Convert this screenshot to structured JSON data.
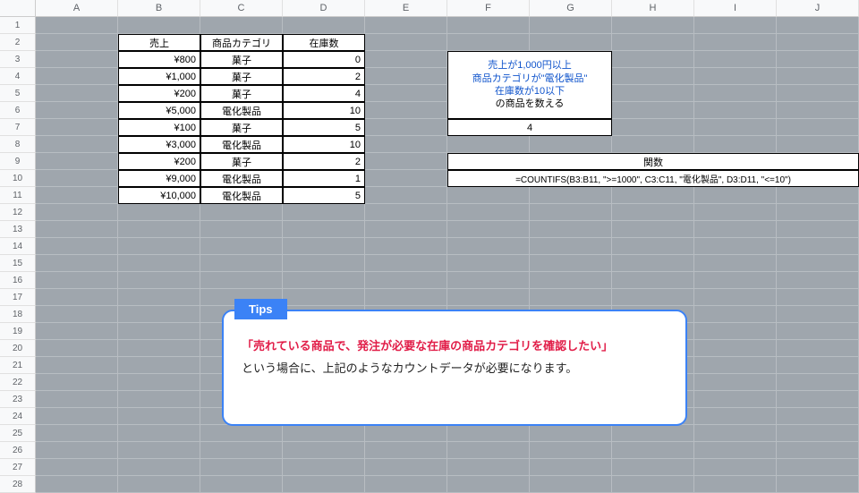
{
  "columns": [
    "A",
    "B",
    "C",
    "D",
    "E",
    "F",
    "G",
    "H",
    "I",
    "J"
  ],
  "rows": 28,
  "table": {
    "headers": [
      "売上",
      "商品カテゴリ",
      "在庫数"
    ],
    "data": [
      {
        "sales": "¥800",
        "cat": "菓子",
        "stock": "0"
      },
      {
        "sales": "¥1,000",
        "cat": "菓子",
        "stock": "2"
      },
      {
        "sales": "¥200",
        "cat": "菓子",
        "stock": "4"
      },
      {
        "sales": "¥5,000",
        "cat": "電化製品",
        "stock": "10"
      },
      {
        "sales": "¥100",
        "cat": "菓子",
        "stock": "5"
      },
      {
        "sales": "¥3,000",
        "cat": "電化製品",
        "stock": "10"
      },
      {
        "sales": "¥200",
        "cat": "菓子",
        "stock": "2"
      },
      {
        "sales": "¥9,000",
        "cat": "電化製品",
        "stock": "1"
      },
      {
        "sales": "¥10,000",
        "cat": "電化製品",
        "stock": "5"
      }
    ]
  },
  "cond": {
    "l1": "売上が1,000円以上",
    "l2": "商品カテゴリが\"電化製品\"",
    "l3": "在庫数が10以下",
    "l4": "の商品を数える"
  },
  "result": "4",
  "fn": {
    "header": "関数",
    "formula": "=COUNTIFS(B3:B11, \">=1000\", C3:C11, \"電化製品\", D3:D11, \"<=10\")"
  },
  "tips": {
    "tab": "Tips",
    "l1": "「売れている商品で、発注が必要な在庫の商品カテゴリを確認したい」",
    "l2": "という場合に、上記のようなカウントデータが必要になります。"
  },
  "chart_data": {
    "type": "table",
    "title": "COUNTIFS example",
    "columns": [
      "売上",
      "商品カテゴリ",
      "在庫数"
    ],
    "rows": [
      [
        800,
        "菓子",
        0
      ],
      [
        1000,
        "菓子",
        2
      ],
      [
        200,
        "菓子",
        4
      ],
      [
        5000,
        "電化製品",
        10
      ],
      [
        100,
        "菓子",
        5
      ],
      [
        3000,
        "電化製品",
        10
      ],
      [
        200,
        "菓子",
        2
      ],
      [
        9000,
        "電化製品",
        1
      ],
      [
        10000,
        "電化製品",
        5
      ]
    ],
    "criteria": {
      "売上": ">=1000",
      "商品カテゴリ": "電化製品",
      "在庫数": "<=10"
    },
    "count_result": 4
  }
}
